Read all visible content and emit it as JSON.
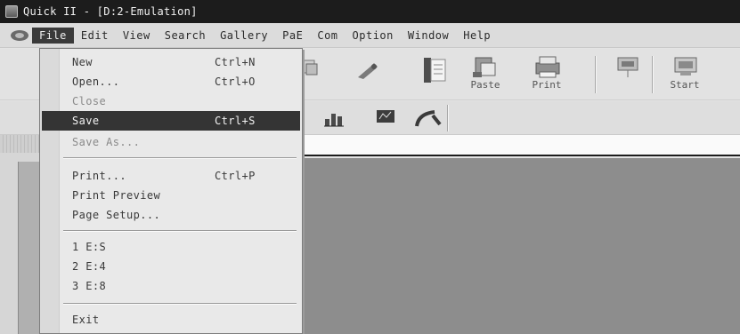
{
  "window": {
    "title": "Quick II - [D:2-Emulation]"
  },
  "menubar": {
    "items": [
      "File",
      "Edit",
      "View",
      "Search",
      "Gallery",
      "PaE",
      "Com",
      "Option",
      "Window",
      "Help"
    ]
  },
  "toolbar": {
    "buttons": [
      {
        "label": "Paste",
        "icon": "paste-icon"
      },
      {
        "label": "Print",
        "icon": "print-icon"
      },
      {
        "label": "",
        "icon": "network-icon"
      },
      {
        "label": "Start",
        "icon": "start-icon"
      }
    ]
  },
  "file_menu": {
    "items": [
      {
        "label": "New",
        "shortcut": "Ctrl+N"
      },
      {
        "label": "Open...",
        "shortcut": "Ctrl+O"
      },
      {
        "label": "Close",
        "shortcut": ""
      },
      {
        "label": "Save",
        "shortcut": "Ctrl+S",
        "highlighted": true
      },
      {
        "label": "Save As...",
        "shortcut": ""
      },
      {
        "label": "Print...",
        "shortcut": "Ctrl+P"
      },
      {
        "label": "Print Preview",
        "shortcut": ""
      },
      {
        "label": "Page Setup...",
        "shortcut": ""
      },
      {
        "label": "1 E:S",
        "shortcut": ""
      },
      {
        "label": "2 E:4",
        "shortcut": ""
      },
      {
        "label": "3 E:8",
        "shortcut": ""
      },
      {
        "label": "Exit",
        "shortcut": ""
      }
    ]
  },
  "colors": {
    "titlebar": "#1c1c1c",
    "highlight": "#343434",
    "workspace": "#8d8d8d"
  }
}
